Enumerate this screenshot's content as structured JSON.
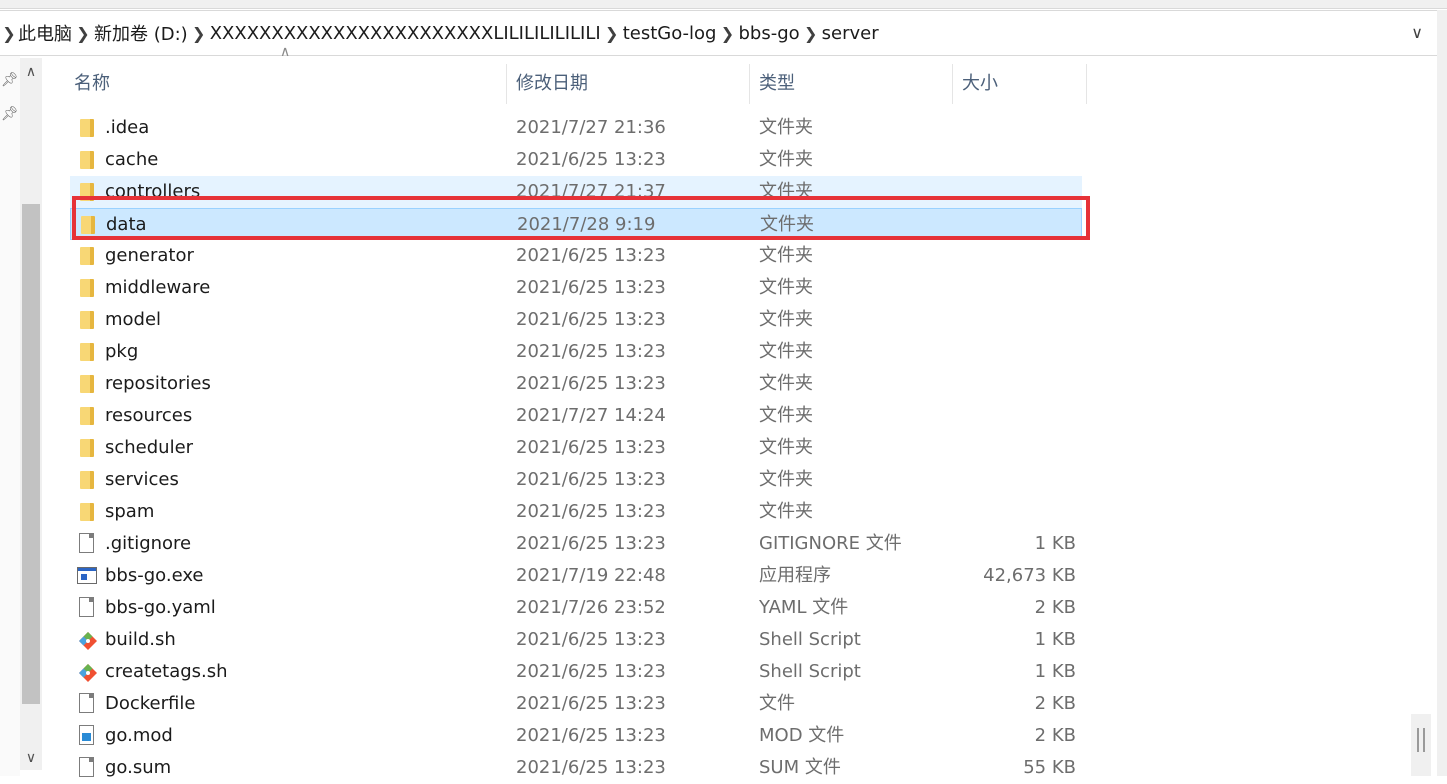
{
  "breadcrumb": {
    "items": [
      "此电脑",
      "新加卷 (D:)",
      "XXXXXXXXXXXXXXXXXXXXXXXLILILILILILILI",
      "testGo-log",
      "bbs-go",
      "server"
    ]
  },
  "columns": {
    "name": "名称",
    "date": "修改日期",
    "type": "类型",
    "size": "大小"
  },
  "files": [
    {
      "name": ".idea",
      "date": "2021/7/27 21:36",
      "type": "文件夹",
      "size": "",
      "icon": "folder-icon"
    },
    {
      "name": "cache",
      "date": "2021/6/25 13:23",
      "type": "文件夹",
      "size": "",
      "icon": "folder-icon"
    },
    {
      "name": "controllers",
      "date": "2021/7/27 21:37",
      "type": "文件夹",
      "size": "",
      "icon": "folder-icon"
    },
    {
      "name": "data",
      "date": "2021/7/28 9:19",
      "type": "文件夹",
      "size": "",
      "icon": "folder-icon"
    },
    {
      "name": "generator",
      "date": "2021/6/25 13:23",
      "type": "文件夹",
      "size": "",
      "icon": "folder-icon"
    },
    {
      "name": "middleware",
      "date": "2021/6/25 13:23",
      "type": "文件夹",
      "size": "",
      "icon": "folder-icon"
    },
    {
      "name": "model",
      "date": "2021/6/25 13:23",
      "type": "文件夹",
      "size": "",
      "icon": "folder-icon"
    },
    {
      "name": "pkg",
      "date": "2021/6/25 13:23",
      "type": "文件夹",
      "size": "",
      "icon": "folder-icon"
    },
    {
      "name": "repositories",
      "date": "2021/6/25 13:23",
      "type": "文件夹",
      "size": "",
      "icon": "folder-icon"
    },
    {
      "name": "resources",
      "date": "2021/7/27 14:24",
      "type": "文件夹",
      "size": "",
      "icon": "folder-icon"
    },
    {
      "name": "scheduler",
      "date": "2021/6/25 13:23",
      "type": "文件夹",
      "size": "",
      "icon": "folder-icon"
    },
    {
      "name": "services",
      "date": "2021/6/25 13:23",
      "type": "文件夹",
      "size": "",
      "icon": "folder-icon"
    },
    {
      "name": "spam",
      "date": "2021/6/25 13:23",
      "type": "文件夹",
      "size": "",
      "icon": "folder-icon"
    },
    {
      "name": ".gitignore",
      "date": "2021/6/25 13:23",
      "type": "GITIGNORE 文件",
      "size": "1 KB",
      "icon": "file-icon"
    },
    {
      "name": "bbs-go.exe",
      "date": "2021/7/19 22:48",
      "type": "应用程序",
      "size": "42,673 KB",
      "icon": "exe-icon"
    },
    {
      "name": "bbs-go.yaml",
      "date": "2021/7/26 23:52",
      "type": "YAML 文件",
      "size": "2 KB",
      "icon": "file-icon"
    },
    {
      "name": "build.sh",
      "date": "2021/6/25 13:23",
      "type": "Shell Script",
      "size": "1 KB",
      "icon": "git-icon"
    },
    {
      "name": "createtags.sh",
      "date": "2021/6/25 13:23",
      "type": "Shell Script",
      "size": "1 KB",
      "icon": "git-icon"
    },
    {
      "name": "Dockerfile",
      "date": "2021/6/25 13:23",
      "type": "文件",
      "size": "2 KB",
      "icon": "file-icon"
    },
    {
      "name": "go.mod",
      "date": "2021/6/25 13:23",
      "type": "MOD 文件",
      "size": "2 KB",
      "icon": "go-icon"
    },
    {
      "name": "go.sum",
      "date": "2021/6/25 13:23",
      "type": "SUM 文件",
      "size": "55 KB",
      "icon": "file-icon"
    }
  ],
  "state": {
    "hovered_row": "controllers",
    "selected_row": "data",
    "highlight_color": "#e63238",
    "selection_color": "#cce8ff",
    "hover_color": "#e5f3ff"
  }
}
